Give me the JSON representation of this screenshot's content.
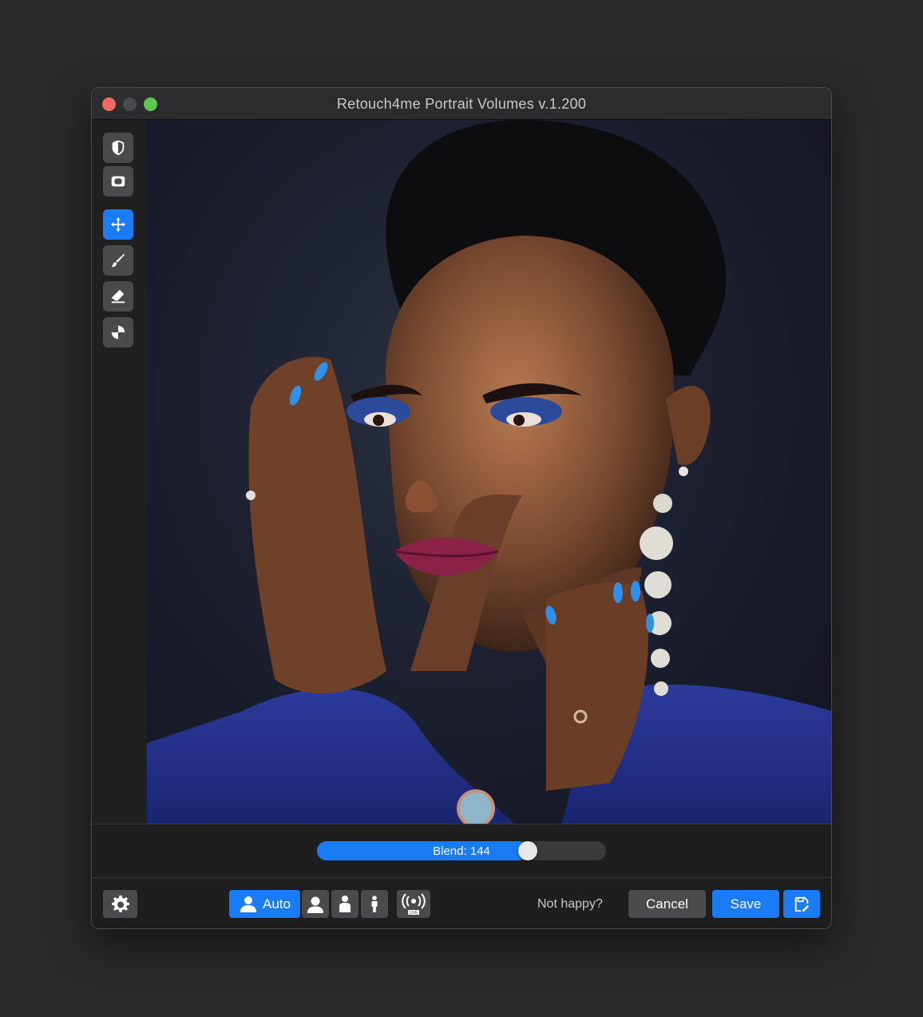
{
  "window": {
    "title": "Retouch4me Portrait Volumes v.1.200"
  },
  "toolbar": {
    "tools": [
      {
        "icon": "half-shield-icon",
        "active": false
      },
      {
        "icon": "frame-icon",
        "active": false
      },
      {
        "icon": "move-icon",
        "active": true
      },
      {
        "icon": "brush-icon",
        "active": false
      },
      {
        "icon": "eraser-icon",
        "active": false
      },
      {
        "icon": "mask-circle-icon",
        "active": false
      }
    ]
  },
  "blend": {
    "label": "Blend: 144",
    "level_percent": 73
  },
  "bottom_bar": {
    "auto_label": "Auto",
    "not_happy_label": "Not happy?",
    "cancel_label": "Cancel",
    "save_label": "Save",
    "live_badge": "LIVE"
  },
  "colors": {
    "accent": "#1a7cf5",
    "button_gray": "#4a4a4c",
    "background": "#2a2a2b"
  }
}
